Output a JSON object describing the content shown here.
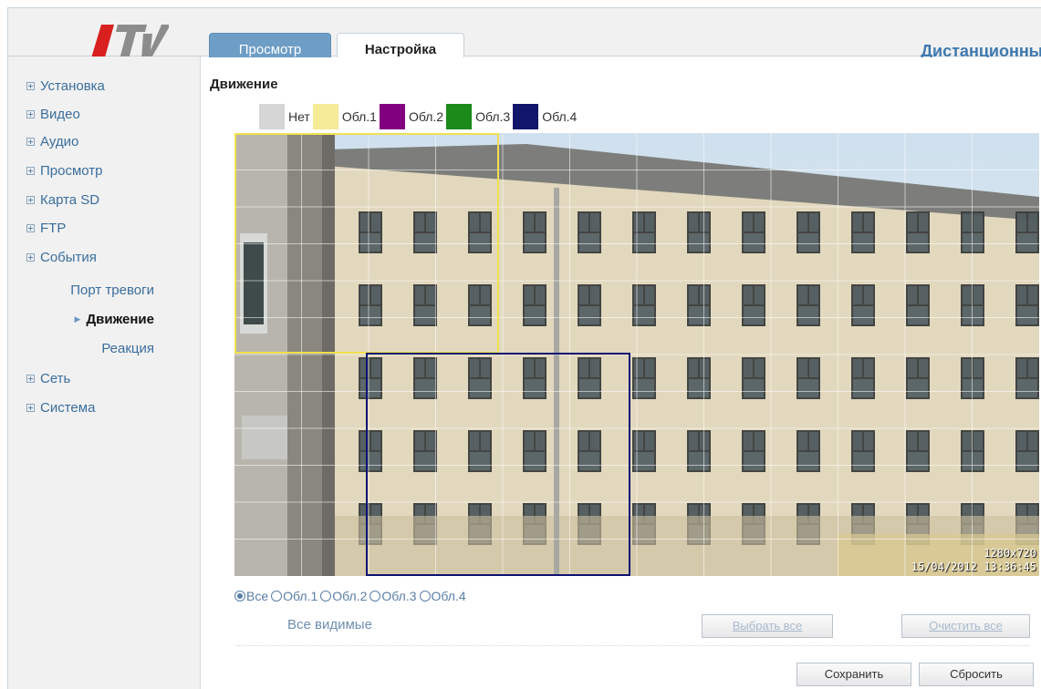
{
  "header": {
    "logo_text": "LTV",
    "title": "Дистанционный пр",
    "tabs": [
      {
        "label": "Просмотр",
        "active": false
      },
      {
        "label": "Настройка",
        "active": true
      }
    ]
  },
  "sidebar": {
    "items": [
      {
        "label": "Установка"
      },
      {
        "label": "Видео"
      },
      {
        "label": "Аудио"
      },
      {
        "label": "Просмотр"
      },
      {
        "label": "Карта SD"
      },
      {
        "label": "FTP"
      },
      {
        "label": "События"
      },
      {
        "label": "Сеть"
      },
      {
        "label": "Система"
      }
    ],
    "events_subitems": [
      {
        "label": "Порт тревоги",
        "active": false
      },
      {
        "label": "Движение",
        "active": true
      },
      {
        "label": "Реакция",
        "active": false
      }
    ]
  },
  "main": {
    "section_title": "Движение",
    "legend": [
      {
        "label": "Нет",
        "color": "#d6d6d6"
      },
      {
        "label": "Обл.1",
        "color": "#f5ea96"
      },
      {
        "label": "Обл.2",
        "color": "#800080"
      },
      {
        "label": "Обл.3",
        "color": "#1a8a1a"
      },
      {
        "label": "Обл.4",
        "color": "#12166b"
      }
    ],
    "video": {
      "resolution": "1280x720",
      "timestamp": "15/04/2012 13:36:45"
    },
    "radios": [
      {
        "label": "Все",
        "checked": true
      },
      {
        "label": "Обл.1",
        "checked": false
      },
      {
        "label": "Обл.2",
        "checked": false
      },
      {
        "label": "Обл.3",
        "checked": false
      },
      {
        "label": "Обл.4",
        "checked": false
      }
    ],
    "all_visible_label": "Все видимые",
    "select_all_label": "Выбрать все",
    "clear_all_label": "Очистить все",
    "save_label": "Сохранить",
    "reset_label": "Сбросить"
  },
  "colors": {
    "accent": "#3e78ad",
    "tab_inactive": "#6e9ec6",
    "zone1_border": "#f0e050",
    "zone4_border": "#0c1270"
  }
}
